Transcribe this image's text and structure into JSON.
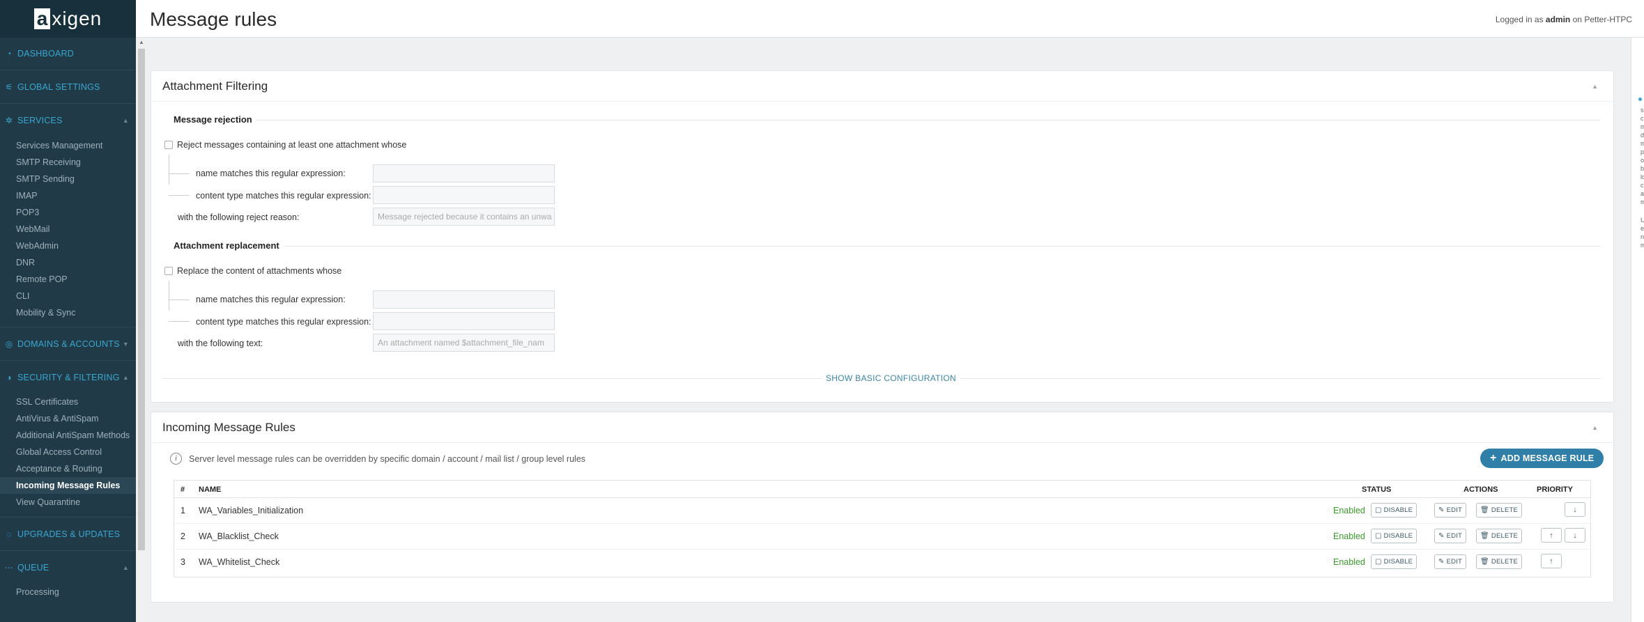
{
  "app": {
    "logo_a": "a",
    "logo_rest": "xigen"
  },
  "header": {
    "title": "Message rules",
    "login_prefix": "Logged in as",
    "user": "admin",
    "login_on": "on",
    "host": "Petter-HTPC"
  },
  "sidebar": {
    "dashboard": "DASHBOARD",
    "global_settings": "GLOBAL SETTINGS",
    "services": "SERVICES",
    "services_items": [
      "Services Management",
      "SMTP Receiving",
      "SMTP Sending",
      "IMAP",
      "POP3",
      "WebMail",
      "WebAdmin",
      "DNR",
      "Remote POP",
      "CLI",
      "Mobility & Sync"
    ],
    "domains_accounts": "DOMAINS & ACCOUNTS",
    "security_filtering": "SECURITY & FILTERING",
    "security_items": [
      "SSL Certificates",
      "AntiVirus & AntiSpam",
      "Additional AntiSpam Methods",
      "Global Access Control",
      "Acceptance & Routing",
      "Incoming Message Rules",
      "View Quarantine"
    ],
    "upgrades": "UPGRADES & UPDATES",
    "queue": "QUEUE",
    "queue_items": [
      "Processing"
    ]
  },
  "attachment_filtering": {
    "title": "Attachment Filtering",
    "rejection": {
      "heading": "Message rejection",
      "checkbox_label": "Reject messages containing at least one attachment whose",
      "name_label": "name matches this regular expression:",
      "content_label": "content type matches this regular expression:",
      "reason_label": "with the following reject reason:",
      "reason_placeholder": "Message rejected because it contains an unwa"
    },
    "replacement": {
      "heading": "Attachment replacement",
      "checkbox_label": "Replace the content of attachments whose",
      "name_label": "name matches this regular expression:",
      "content_label": "content type matches this regular expression:",
      "text_label": "with the following text:",
      "text_placeholder": "An attachment named $attachment_file_nam"
    },
    "show_basic": "SHOW BASIC CONFIGURATION"
  },
  "incoming_rules": {
    "title": "Incoming Message Rules",
    "info": "Server level message rules can be overridden by specific domain / account / mail list / group level rules",
    "add_button": "ADD MESSAGE RULE",
    "columns": {
      "num": "#",
      "name": "NAME",
      "status": "STATUS",
      "actions": "ACTIONS",
      "priority": "PRIORITY"
    },
    "action_labels": {
      "disable": "DISABLE",
      "edit": "EDIT",
      "delete": "DELETE"
    },
    "rows": [
      {
        "num": "1",
        "name": "WA_Variables_Initialization",
        "status": "Enabled"
      },
      {
        "num": "2",
        "name": "WA_Blacklist_Check",
        "status": "Enabled"
      },
      {
        "num": "3",
        "name": "WA_Whitelist_Check",
        "status": "Enabled"
      }
    ]
  },
  "right_strip": {
    "letters": [
      "s",
      "c",
      "m",
      "d",
      "m",
      "p",
      "o",
      "b",
      "lo",
      "c",
      "a",
      "m",
      "U",
      "e",
      "n",
      "m"
    ]
  },
  "colors": {
    "sidebar_bg": "#203a48",
    "accent": "#3aa7d0",
    "button": "#2f7fa8",
    "enabled": "#3a9a2a"
  }
}
